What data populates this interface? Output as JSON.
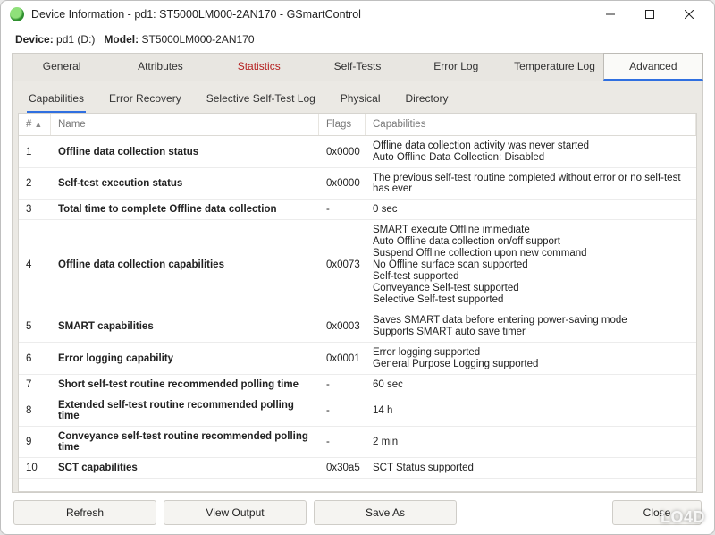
{
  "window": {
    "title": "Device Information - pd1: ST5000LM000-2AN170 - GSmartControl"
  },
  "device_line": {
    "device_label": "Device:",
    "device_value": "pd1 (D:)",
    "model_label": "Model:",
    "model_value": "ST5000LM000-2AN170"
  },
  "main_tabs": [
    "General",
    "Attributes",
    "Statistics",
    "Self-Tests",
    "Error Log",
    "Temperature Log",
    "Advanced"
  ],
  "main_tab_active": 6,
  "stat_tab_index": 2,
  "sub_tabs": [
    "Capabilities",
    "Error Recovery",
    "Selective Self-Test Log",
    "Physical",
    "Directory"
  ],
  "sub_tab_active": 0,
  "columns": {
    "num": "#",
    "name": "Name",
    "flags": "Flags",
    "cap": "Capabilities"
  },
  "rows": [
    {
      "n": "1",
      "name": "Offline data collection status",
      "flags": "0x0000",
      "cap": [
        "Offline data collection activity was never started",
        "Auto Offline Data Collection: Disabled"
      ]
    },
    {
      "n": "2",
      "name": "Self-test execution status",
      "flags": "0x0000",
      "cap": [
        "The previous self-test routine completed without error or no self-test has ever"
      ]
    },
    {
      "n": "3",
      "name": "Total time to complete Offline data collection",
      "flags": "-",
      "cap": [
        "0 sec"
      ]
    },
    {
      "n": "4",
      "name": "Offline data collection capabilities",
      "flags": "0x0073",
      "cap": [
        "SMART execute Offline immediate",
        "Auto Offline data collection on/off support",
        "Suspend Offline collection upon new command",
        "No Offline surface scan supported",
        "Self-test supported",
        "Conveyance Self-test supported",
        "Selective Self-test supported"
      ]
    },
    {
      "n": "5",
      "name": "SMART capabilities",
      "flags": "0x0003",
      "cap": [
        "Saves SMART data before entering power-saving mode",
        "Supports SMART auto save timer"
      ]
    },
    {
      "n": "6",
      "name": "Error logging capability",
      "flags": "0x0001",
      "cap": [
        "Error logging supported",
        "General Purpose Logging supported"
      ]
    },
    {
      "n": "7",
      "name": "Short self-test routine recommended polling time",
      "flags": "-",
      "cap": [
        "60 sec"
      ]
    },
    {
      "n": "8",
      "name": "Extended self-test routine recommended polling time",
      "flags": "-",
      "cap": [
        "14 h"
      ]
    },
    {
      "n": "9",
      "name": "Conveyance self-test routine recommended polling time",
      "flags": "-",
      "cap": [
        "2 min"
      ]
    },
    {
      "n": "10",
      "name": "SCT capabilities",
      "flags": "0x30a5",
      "cap": [
        "SCT Status supported"
      ]
    }
  ],
  "buttons": {
    "refresh": "Refresh",
    "view_output": "View Output",
    "save_as": "Save As",
    "close": "Close"
  },
  "watermark": "LO4D"
}
